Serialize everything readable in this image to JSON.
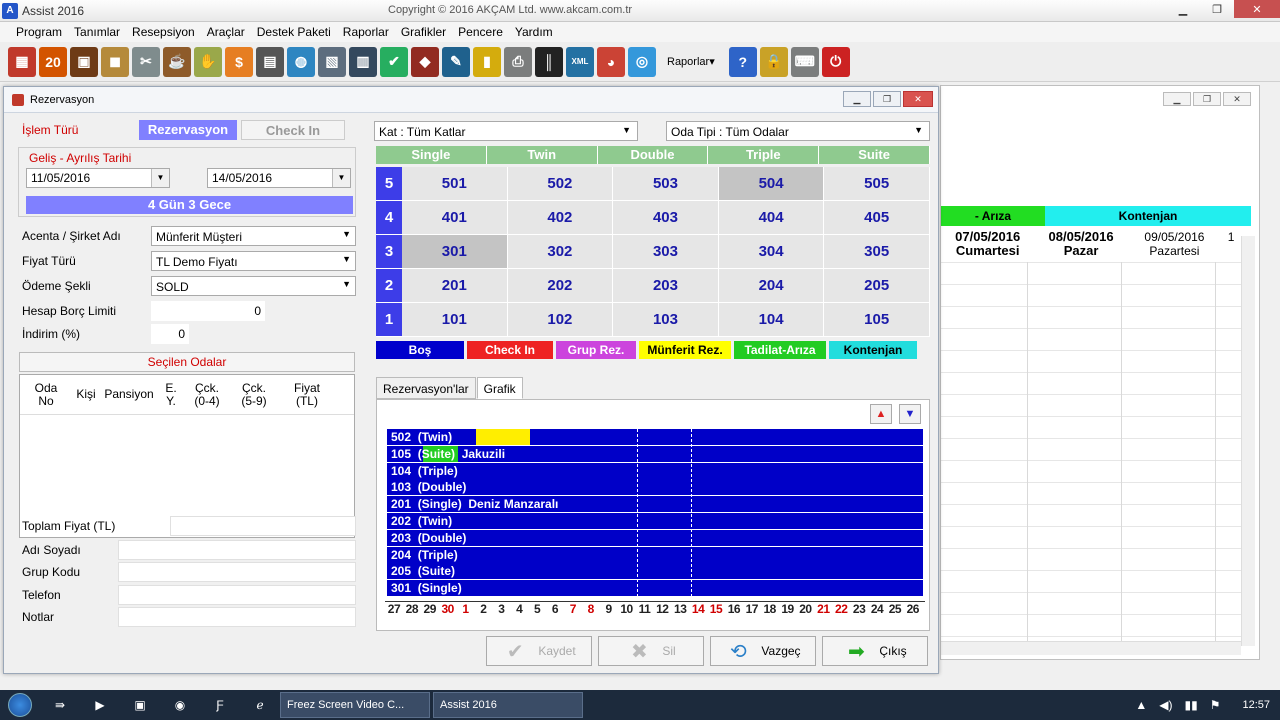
{
  "app": {
    "title": "Assist 2016",
    "copyright": "Copyright ©  2016 AKÇAM Ltd.    www.akcam.com.tr"
  },
  "menu": [
    "Program",
    "Tanımlar",
    "Resepsiyon",
    "Araçlar",
    "Destek Paketi",
    "Raporlar",
    "Grafikler",
    "Pencere",
    "Yardım"
  ],
  "toolbar": {
    "raporlar_label": "Raporlar",
    "icons": [
      {
        "name": "calendar-icon",
        "color": "#c0392b",
        "glyph": "▦"
      },
      {
        "name": "calendar-day-icon",
        "color": "#d35400",
        "glyph": "20"
      },
      {
        "name": "suitcase-icon",
        "color": "#6e3b16",
        "glyph": "▣"
      },
      {
        "name": "package-icon",
        "color": "#b58a3b",
        "glyph": "◼"
      },
      {
        "name": "tools-icon",
        "color": "#7f8c8d",
        "glyph": "✂"
      },
      {
        "name": "coffee-icon",
        "color": "#8e5b2a",
        "glyph": "☕"
      },
      {
        "name": "handshake-icon",
        "color": "#9aa84a",
        "glyph": "✋"
      },
      {
        "name": "dollar-icon",
        "color": "#e67e22",
        "glyph": "$"
      },
      {
        "name": "document-icon",
        "color": "#555555",
        "glyph": "▤"
      },
      {
        "name": "globe-icon",
        "color": "#2e86c1",
        "glyph": "◍"
      },
      {
        "name": "guest-card-icon",
        "color": "#5d6d7e",
        "glyph": "▧"
      },
      {
        "name": "calculator-icon",
        "color": "#34495e",
        "glyph": "▥"
      },
      {
        "name": "checklist-icon",
        "color": "#27ae60",
        "glyph": "✔"
      },
      {
        "name": "book-icon",
        "color": "#922b21",
        "glyph": "◆"
      },
      {
        "name": "settings-globe-icon",
        "color": "#1f618d",
        "glyph": "✎"
      },
      {
        "name": "folder-icon",
        "color": "#d4ac0d",
        "glyph": "▮"
      },
      {
        "name": "printer-icon",
        "color": "#7b7d7d",
        "glyph": "⎙"
      },
      {
        "name": "barcode-icon",
        "color": "#222222",
        "glyph": "║"
      },
      {
        "name": "xml-icon",
        "color": "#2471a3",
        "glyph": "XML"
      },
      {
        "name": "pie-chart-icon",
        "color": "#cb4335",
        "glyph": "◕"
      },
      {
        "name": "report-globe-icon",
        "color": "#3498db",
        "glyph": "◎"
      }
    ],
    "right_icons": [
      {
        "name": "help-icon",
        "color": "#2e64c8",
        "glyph": "?"
      },
      {
        "name": "lock-icon",
        "color": "#c9a227",
        "glyph": "🔒"
      },
      {
        "name": "keyboard-icon",
        "color": "#7b7d7d",
        "glyph": "⌨"
      },
      {
        "name": "power-icon",
        "color": "#cc2222",
        "glyph": "⏻"
      }
    ]
  },
  "bg_window": {
    "headers": [
      {
        "label": "- Arıza",
        "color": "#22dd22",
        "width": 104
      },
      {
        "label": "Kontenjan",
        "color": "#22eeee",
        "width": 206
      }
    ],
    "dates": [
      {
        "date": "07/05/2016",
        "day": "Cumartesi",
        "bold": true
      },
      {
        "date": "08/05/2016",
        "day": "Pazar",
        "bold": true
      },
      {
        "date": "09/05/2016",
        "day": "Pazartesi",
        "bold": false
      }
    ],
    "extra": "1"
  },
  "rez": {
    "window_title": "Rezervasyon",
    "islem_turu": "İşlem Türü",
    "btn_rez": "Rezervasyon",
    "btn_checkin": "Check In",
    "date_group_title": "Geliş - Ayrılış Tarihi",
    "date_from": "11/05/2016",
    "date_to": "14/05/2016",
    "nights": "4 Gün 3 Gece",
    "acenta_lbl": "Acenta / Şirket Adı",
    "acenta_val": "Münferit Müşteri",
    "fiyat_lbl": "Fiyat Türü",
    "fiyat_val": "TL Demo Fiyatı",
    "odeme_lbl": "Ödeme Şekli",
    "odeme_val": "SOLD",
    "borc_lbl": "Hesap Borç Limiti",
    "borc_val": "0",
    "indirim_lbl": "İndirim (%)",
    "indirim_val": "0",
    "secilen_title": "Seçilen Odalar",
    "secilen_cols": [
      {
        "label": "Oda\nNo",
        "w": 52
      },
      {
        "label": "Kişi",
        "w": 28
      },
      {
        "label": "Pansiyon",
        "w": 58
      },
      {
        "label": "E.\nY.",
        "w": 26
      },
      {
        "label": "Çck.\n(0-4)",
        "w": 46
      },
      {
        "label": "Çck.\n(5-9)",
        "w": 48
      },
      {
        "label": "Fiyat\n(TL)",
        "w": 58
      }
    ],
    "toplam_lbl": "Toplam Fiyat (TL)",
    "adi_lbl": "Adı Soyadı",
    "grup_lbl": "Grup Kodu",
    "telefon_lbl": "Telefon",
    "notlar_lbl": "Notlar"
  },
  "rooms": {
    "kat_select": "Kat : Tüm Katlar",
    "oda_tipi_select": "Oda Tipi : Tüm Odalar",
    "types": [
      "Single",
      "Twin",
      "Double",
      "Triple",
      "Suite"
    ],
    "floors": [
      {
        "floor": "5",
        "rooms": [
          "501",
          "502",
          "503",
          "504",
          "505"
        ],
        "occ": [
          false,
          false,
          false,
          true,
          false
        ]
      },
      {
        "floor": "4",
        "rooms": [
          "401",
          "402",
          "403",
          "404",
          "405"
        ],
        "occ": [
          false,
          false,
          false,
          false,
          false
        ]
      },
      {
        "floor": "3",
        "rooms": [
          "301",
          "302",
          "303",
          "304",
          "305"
        ],
        "occ": [
          true,
          false,
          false,
          false,
          false
        ]
      },
      {
        "floor": "2",
        "rooms": [
          "201",
          "202",
          "203",
          "204",
          "205"
        ],
        "occ": [
          false,
          false,
          false,
          false,
          false
        ]
      },
      {
        "floor": "1",
        "rooms": [
          "101",
          "102",
          "103",
          "104",
          "105"
        ],
        "occ": [
          false,
          false,
          false,
          false,
          false
        ]
      }
    ],
    "legend": [
      {
        "label": "Boş",
        "bg": "#0000cc",
        "fg": "#ffffff",
        "w": 88
      },
      {
        "label": "Check In",
        "bg": "#ee2222",
        "fg": "#ffffff",
        "w": 86
      },
      {
        "label": "Grup Rez.",
        "bg": "#cc44dd",
        "fg": "#ffffff",
        "w": 80
      },
      {
        "label": "Münferit Rez.",
        "bg": "#ffff00",
        "fg": "#000000",
        "w": 92
      },
      {
        "label": "Tadilat-Arıza",
        "bg": "#22cc22",
        "fg": "#ffffff",
        "w": 92
      },
      {
        "label": "Kontenjan",
        "bg": "#22dddd",
        "fg": "#000000",
        "w": 88
      }
    ]
  },
  "tabs": [
    "Rezervasyon'lar",
    "Grafik"
  ],
  "gantt": {
    "rows": [
      {
        "label": "502  (Twin)",
        "bar": {
          "start": 5,
          "end": 8,
          "color": "#ffee00"
        }
      },
      {
        "label": "105  (Suite)  Jakuzili",
        "bar": {
          "start": 2,
          "end": 4,
          "color": "#22cc22"
        }
      },
      {
        "label": "104  (Triple)"
      },
      {
        "label": "103  (Double)"
      },
      {
        "label": "201  (Single)  Deniz Manzaralı"
      },
      {
        "label": "202  (Twin)"
      },
      {
        "label": "203  (Double)"
      },
      {
        "label": "204  (Triple)"
      },
      {
        "label": "205  (Suite)"
      },
      {
        "label": "301  (Single)"
      }
    ],
    "markers": [
      14,
      17
    ],
    "days": [
      {
        "d": "27",
        "r": false
      },
      {
        "d": "28",
        "r": false
      },
      {
        "d": "29",
        "r": false
      },
      {
        "d": "30",
        "r": true
      },
      {
        "d": "1",
        "r": true
      },
      {
        "d": "2",
        "r": false
      },
      {
        "d": "3",
        "r": false
      },
      {
        "d": "4",
        "r": false
      },
      {
        "d": "5",
        "r": false
      },
      {
        "d": "6",
        "r": false
      },
      {
        "d": "7",
        "r": true
      },
      {
        "d": "8",
        "r": true
      },
      {
        "d": "9",
        "r": false
      },
      {
        "d": "10",
        "r": false
      },
      {
        "d": "11",
        "r": false
      },
      {
        "d": "12",
        "r": false
      },
      {
        "d": "13",
        "r": false
      },
      {
        "d": "14",
        "r": true
      },
      {
        "d": "15",
        "r": true
      },
      {
        "d": "16",
        "r": false
      },
      {
        "d": "17",
        "r": false
      },
      {
        "d": "18",
        "r": false
      },
      {
        "d": "19",
        "r": false
      },
      {
        "d": "20",
        "r": false
      },
      {
        "d": "21",
        "r": true
      },
      {
        "d": "22",
        "r": true
      },
      {
        "d": "23",
        "r": false
      },
      {
        "d": "24",
        "r": false
      },
      {
        "d": "25",
        "r": false
      },
      {
        "d": "26",
        "r": false
      }
    ]
  },
  "buttons": {
    "kaydet": "Kaydet",
    "sil": "Sil",
    "vazgec": "Vazgeç",
    "cikis": "Çıkış"
  },
  "taskbar": {
    "apps": [
      "Freez Screen Video C...",
      "Assist 2016"
    ],
    "clock": "12:57"
  }
}
